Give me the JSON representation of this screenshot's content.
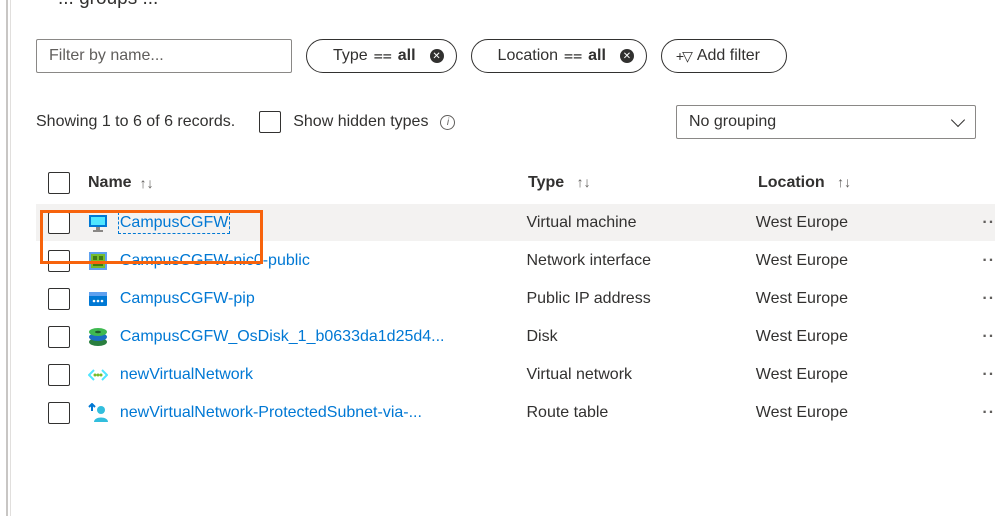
{
  "top_cut_text": "... groups ...",
  "filter": {
    "placeholder": "Filter by name..."
  },
  "pills": [
    {
      "field": "Type",
      "op": "==",
      "value": "all"
    },
    {
      "field": "Location",
      "op": "==",
      "value": "all"
    }
  ],
  "add_filter_label": "Add filter",
  "records_text": "Showing 1 to 6 of 6 records.",
  "show_hidden_label": "Show hidden types",
  "grouping_value": "No grouping",
  "columns": {
    "name": "Name",
    "type": "Type",
    "location": "Location",
    "sort_glyph": "↑↓"
  },
  "rows": [
    {
      "name": "CampusCGFW",
      "type": "Virtual machine",
      "location": "West Europe",
      "icon": "vm-icon"
    },
    {
      "name": "CampusCGFW-nic0-public",
      "type": "Network interface",
      "location": "West Europe",
      "icon": "nic-icon"
    },
    {
      "name": "CampusCGFW-pip",
      "type": "Public IP address",
      "location": "West Europe",
      "icon": "pip-icon"
    },
    {
      "name": "CampusCGFW_OsDisk_1_b0633da1d25d4...",
      "type": "Disk",
      "location": "West Europe",
      "icon": "disk-icon"
    },
    {
      "name": "newVirtualNetwork",
      "type": "Virtual network",
      "location": "West Europe",
      "icon": "vnet-icon"
    },
    {
      "name": "newVirtualNetwork-ProtectedSubnet-via-...",
      "type": "Route table",
      "location": "West Europe",
      "icon": "route-table-icon"
    }
  ],
  "more_glyph": "··",
  "colors": {
    "link": "#0078d4",
    "highlight": "#f7630c",
    "selected_row": "#f3f2f1"
  }
}
